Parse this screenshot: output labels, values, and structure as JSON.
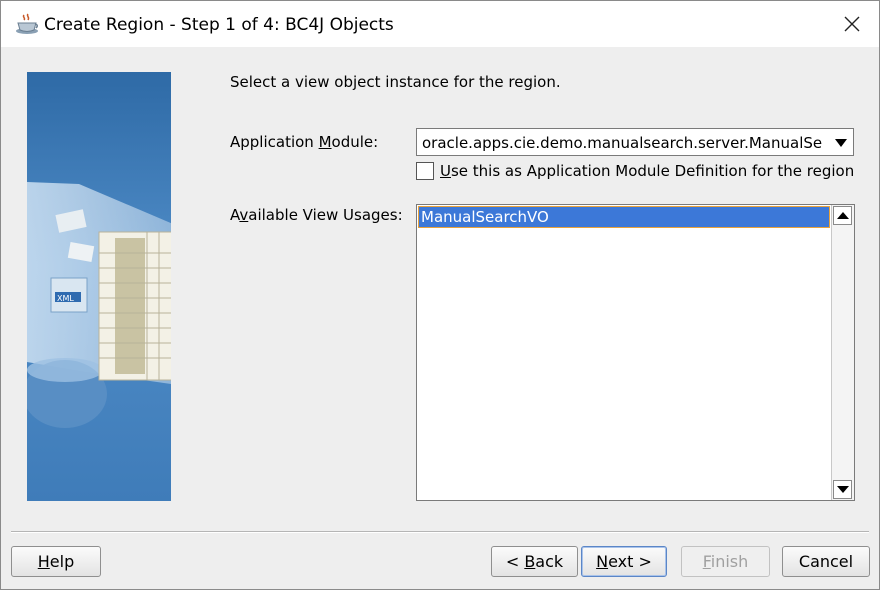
{
  "window": {
    "title": "Create Region - Step 1 of 4: BC4J Objects",
    "icon": "coffee-cup-icon",
    "close_icon": "close-icon"
  },
  "wizard_image": {
    "icon": "wizard-illustration",
    "badge_text": "XML"
  },
  "content": {
    "instruction": "Select a view object instance for the region.",
    "application_module": {
      "label_before": "Application ",
      "label_mnemonic": "M",
      "label_after": "odule:",
      "value": "oracle.apps.cie.demo.manualsearch.server.ManualSe..."
    },
    "checkbox": {
      "checked": false,
      "label_mnemonic": "U",
      "label_after": "se this as Application Module Definition for the region"
    },
    "available_view_usages": {
      "label_before": "A",
      "label_mnemonic": "v",
      "label_after": "ailable View Usages:",
      "items": [
        "ManualSearchVO"
      ],
      "selected_index": 0
    }
  },
  "buttons": {
    "help": {
      "mnemonic": "H",
      "rest": "elp"
    },
    "back": {
      "prefix": "< ",
      "mnemonic": "B",
      "rest": "ack"
    },
    "next": {
      "mnemonic": "N",
      "rest": "ext >"
    },
    "finish": {
      "mnemonic": "F",
      "rest": "inish",
      "enabled": false
    },
    "cancel": {
      "label": "Cancel"
    }
  },
  "colors": {
    "selection_bg": "#3c78d8",
    "selection_border": "#e9a23b",
    "dialog_bg": "#eeeeee",
    "wizard_blue": "#4a84c0"
  }
}
